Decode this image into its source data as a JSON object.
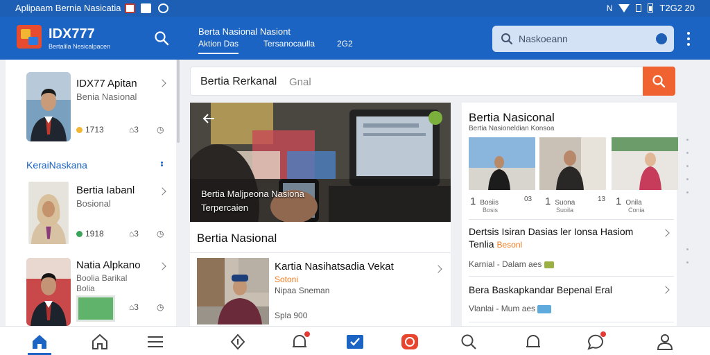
{
  "status_bar": {
    "title": "Aplipaam Bernia Nasicatia",
    "time": "T2G2 20"
  },
  "app_bar": {
    "brand": "IDX777",
    "brand_sub": "Bertalila Nesicalpacen",
    "tab_group_title": "Berta Nasional Nasiont",
    "tabs": [
      "Aktion Das",
      "Tersanocaulla",
      "2G2"
    ],
    "search_placeholder": "Naskoeann"
  },
  "left_list": {
    "items": [
      {
        "title": "IDX77 Apitan",
        "subtitle": "Benia Nasional",
        "meta": "1713",
        "count": "3"
      },
      {
        "title": "Bertia Iabanl",
        "subtitle": "Bosional",
        "meta": "1918",
        "count": "3"
      },
      {
        "title": "Natia Alpkano",
        "subtitle": "Boolia Barikal",
        "meta": "Bolia",
        "count": "3"
      }
    ],
    "section_title": "KeraiNaskana"
  },
  "mid_search": {
    "query": "Bertia Rerkanal",
    "hint": "Gnal"
  },
  "hero": {
    "line1": "Bertia Maljpeona Nasiona",
    "line2": "Terpercaien"
  },
  "mid_card": {
    "title": "Bertia Nasional",
    "news": {
      "title": "Kartia Nasihatsadia Vekat",
      "tag": "Sotoni",
      "subtitle": "Nipaa Sneman",
      "meta": "Spla 900"
    }
  },
  "right_panel": {
    "title": "Bertia Nasiconal",
    "subtitle": "Bertia Nasioneldian Konsoa",
    "photos": [
      {
        "num": "1",
        "cap1": "Bosiis",
        "cap2": "Bosis",
        "count": "03"
      },
      {
        "num": "1",
        "cap1": "Suona",
        "cap2": "Suoila",
        "count": "13"
      },
      {
        "num": "1",
        "cap1": "Onila",
        "cap2": "Conia",
        "count": ""
      }
    ],
    "stories": [
      {
        "title": "Dertsis Isiran Dasias ler Ionsa Hasiom",
        "line2_prefix": "Tenlia",
        "line2_accent": "Besonl",
        "meta": "Karnial - Dalam aes"
      },
      {
        "title": "Bera Baskapkandar Bepenal Eral",
        "meta": "Vlanlai - Mum aes"
      }
    ]
  },
  "colors": {
    "primary": "#1c64c4",
    "accent": "#f0622f",
    "statusbar": "#1d5fb4"
  }
}
